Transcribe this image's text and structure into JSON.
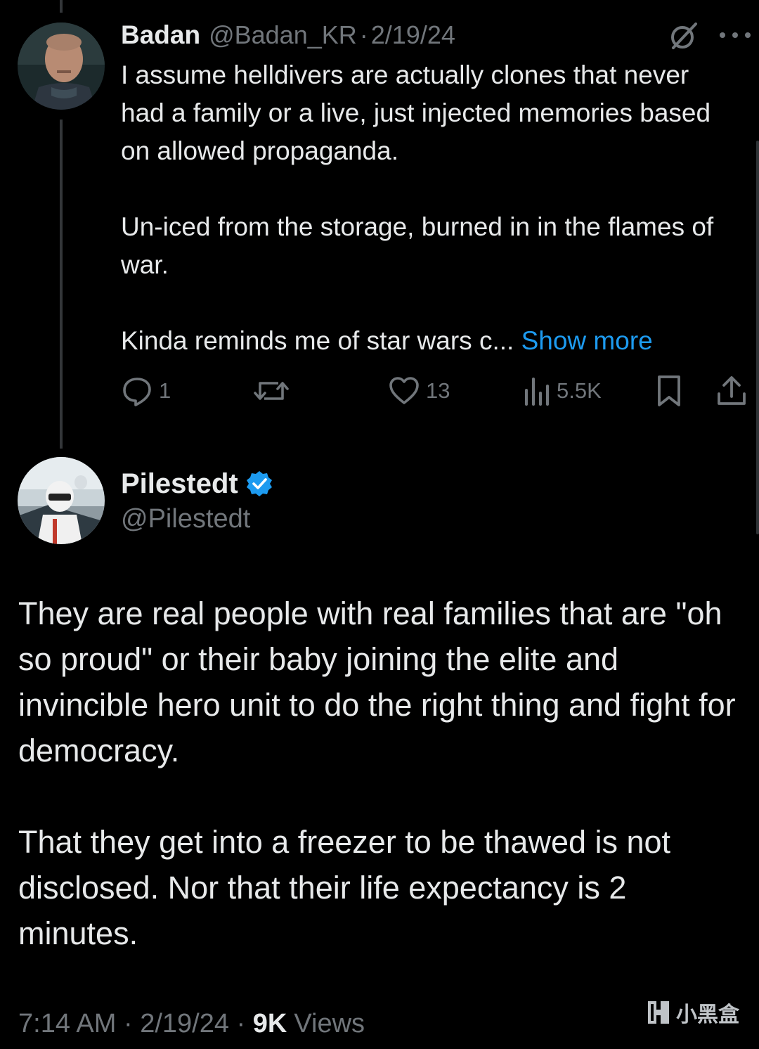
{
  "reply": {
    "name": "Badan",
    "handle": "@Badan_KR",
    "separator": "·",
    "date": "2/19/24",
    "paragraphs": [
      "I assume helldivers are actually clones that never had a family or a live, just injected memories based on allowed propaganda.",
      "Un-iced from the storage, burned in in the flames of war.",
      "Kinda reminds me of star wars c... "
    ],
    "show_more": "Show more",
    "actions": {
      "replies": "1",
      "reposts": "",
      "likes": "13",
      "views": "5.5K"
    }
  },
  "main": {
    "name": "Pilestedt",
    "handle": "@Pilestedt",
    "paragraphs": [
      "They are real people with real families that are \"oh so proud\" or their baby joining the elite and invincible hero unit to do the right thing and fight for democracy.",
      "That they get into a freezer to be thawed is not disclosed. Nor that their life expectancy is 2 minutes."
    ],
    "footer": {
      "time": "7:14 AM",
      "separator": " · ",
      "date": "2/19/24",
      "views_count": "9K",
      "views_label": "Views"
    }
  },
  "watermark": {
    "text": "小黑盒"
  },
  "colors": {
    "background": "#000000",
    "text": "#e7e9ea",
    "secondary": "#71767b",
    "accent": "#1d9bf0"
  },
  "icons": [
    "grok-icon",
    "more-icon",
    "reply-icon",
    "repost-icon",
    "like-icon",
    "views-icon",
    "bookmark-icon",
    "share-icon",
    "verified-badge-icon",
    "watermark-logo-icon"
  ]
}
